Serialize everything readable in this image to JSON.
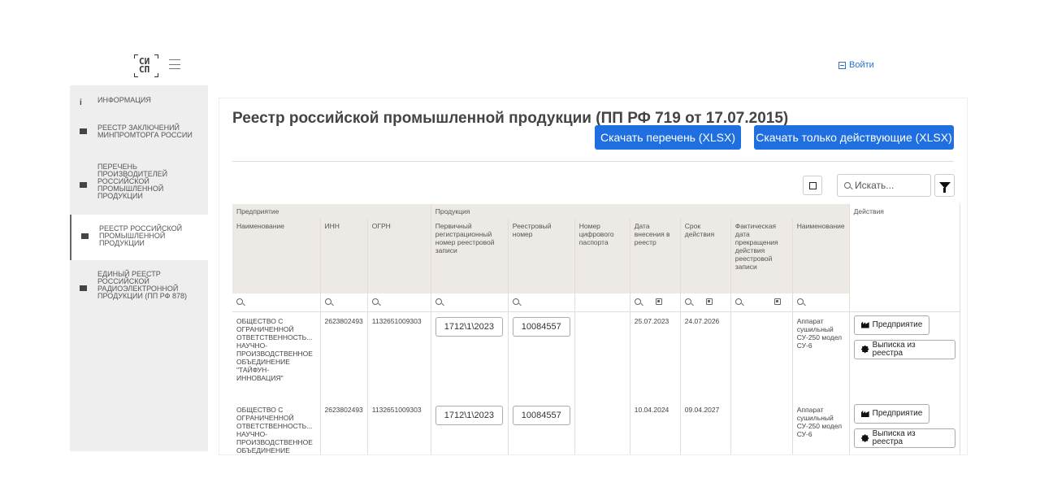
{
  "header": {
    "login_label": "Войти"
  },
  "sidebar": {
    "items": [
      {
        "label": "ИНФОРМАЦИЯ",
        "icon": "info-icon"
      },
      {
        "label": "РЕЕСТР ЗАКЛЮЧЕНИЙ МИНПРОМТОРГА РОССИИ",
        "icon": "book-icon"
      },
      {
        "label": "ПЕРЕЧЕНЬ ПРОИЗВОДИТЕЛЕЙ РОССИЙСКОЙ ПРОМЫШЛЕННОЙ ПРОДУКЦИИ",
        "icon": "book-icon"
      },
      {
        "label": "РЕЕСТР РОССИЙСКОЙ ПРОМЫШЛЕННОЙ ПРОДУКЦИИ",
        "icon": "book-icon",
        "active": true
      },
      {
        "label": "ЕДИНЫЙ РЕЕСТР РОССИЙСКОЙ РАДИОЭЛЕКТРОННОЙ ПРОДУКЦИИ (ПП РФ 878)",
        "icon": "book-icon"
      }
    ]
  },
  "main": {
    "title": "Реестр российской промышленной продукции (ПП РФ 719 от 17.07.2015)",
    "download_all": "Скачать перечень (XLSX)",
    "download_active": "Скачать только действующие (XLSX)",
    "search_placeholder": "Искать..."
  },
  "table": {
    "groups": {
      "enterprise": "Предприятие",
      "product": "Продукция",
      "actions": "Действия"
    },
    "columns": [
      "Наименование",
      "ИНН",
      "ОГРН",
      "Первичный регистрационный номер реестровой записи",
      "Реестровый номер",
      "Номер цифрового паспорта",
      "Дата внесения в реестр",
      "Срок действия",
      "Фактическая дата прекращения действия реестровой записи",
      "Наименование"
    ],
    "rows": [
      {
        "name": "ОБЩЕСТВО С ОГРАНИЧЕННОЙ ОТВЕТСТВЕННОСТЬ... НАУЧНО-ПРОИЗВОДСТВЕННОЕ ОБЪЕДИНЕНИЕ \"ТАЙФУН-ИННОВАЦИЯ\"",
        "inn": "2623802493",
        "ogrn": "1132651009303",
        "primary": "1712\\1\\2023",
        "registry": "10084557",
        "passport": "",
        "added": "25.07.2023",
        "valid": "24.07.2026",
        "ended": "",
        "product": "Аппарат сушильный СУ-250 модел СУ-6",
        "btn_enterprise": "Предприятие",
        "btn_extract": "Выписка из реестра"
      },
      {
        "name": "ОБЩЕСТВО С ОГРАНИЧЕННОЙ ОТВЕТСТВЕННОСТЬ... НАУЧНО-ПРОИЗВОДСТВЕННОЕ ОБЪЕДИНЕНИЕ",
        "inn": "2623802493",
        "ogrn": "1132651009303",
        "primary": "1712\\1\\2023",
        "registry": "10084557",
        "passport": "",
        "added": "10.04.2024",
        "valid": "09.04.2027",
        "ended": "",
        "product": "Аппарат сушильный СУ-250 модел СУ-6",
        "btn_enterprise": "Предприятие",
        "btn_extract": "Выписка из реестра"
      }
    ]
  }
}
